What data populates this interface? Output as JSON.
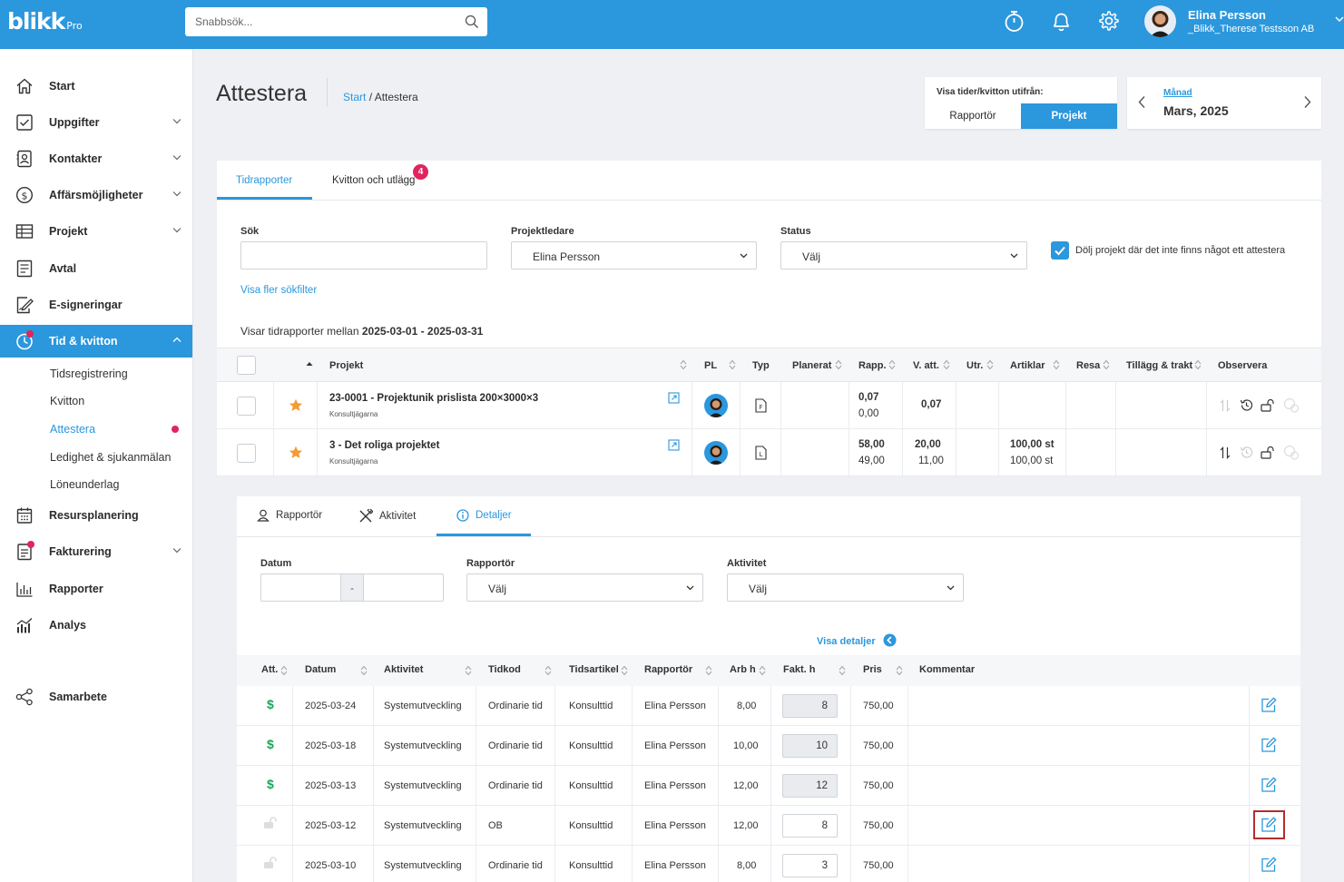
{
  "colors": {
    "brand": "#2b97dd",
    "badge": "#e0245e",
    "dollar": "#1aa35c",
    "highlight": "#b32d2d"
  },
  "topbar": {
    "logo_main": "blikk",
    "logo_sub": "Pro",
    "search_placeholder": "Snabbsök...",
    "icons": [
      "stopwatch-icon",
      "bell-icon",
      "gear-icon"
    ],
    "user_name": "Elina Persson",
    "user_org": "_Blikk_Therese Testsson AB"
  },
  "sidebar": {
    "items": [
      {
        "label": "Start",
        "icon": "home-icon"
      },
      {
        "label": "Uppgifter",
        "icon": "checkbox-icon"
      },
      {
        "label": "Kontakter",
        "icon": "contacts-icon"
      },
      {
        "label": "Affärsmöjligheter",
        "icon": "dollar-circle-icon"
      },
      {
        "label": "Projekt",
        "icon": "grid-icon"
      },
      {
        "label": "Avtal",
        "icon": "document-icon"
      },
      {
        "label": "E-signeringar",
        "icon": "signature-icon"
      },
      {
        "label": "Tid & kvitton",
        "icon": "clock-icon"
      },
      {
        "label": "Resursplanering",
        "icon": "calendar-icon"
      },
      {
        "label": "Fakturering",
        "icon": "invoice-icon"
      },
      {
        "label": "Rapporter",
        "icon": "bar-chart-icon"
      },
      {
        "label": "Analys",
        "icon": "analysis-icon"
      },
      {
        "label": "Samarbete",
        "icon": "share-icon"
      }
    ],
    "sub_items": [
      "Tidsregistrering",
      "Kvitton",
      "Attestera",
      "Ledighet & sjukanmälan",
      "Löneunderlag"
    ]
  },
  "header": {
    "title": "Attestera",
    "crumb_start": "Start",
    "crumb_sep": "/",
    "crumb_current": "Attestera"
  },
  "view": {
    "label": "Visa tider/kvitton utifrån:",
    "options": [
      "Rapportör",
      "Projekt"
    ],
    "selected": "Projekt"
  },
  "period": {
    "mode": "Månad",
    "value": "Mars, 2025"
  },
  "tabs": [
    {
      "label": "Tidrapporter"
    },
    {
      "label": "Kvitton och utlägg",
      "badge": "4"
    }
  ],
  "filters": {
    "search_label": "Sök",
    "search_value": "",
    "pl_label": "Projektledare",
    "pl_value": "Elina Persson",
    "status_label": "Status",
    "status_value": "Välj",
    "hide_label": "Dölj projekt där det inte finns något ett attestera",
    "more_filters": "Visa fler sökfilter"
  },
  "range": {
    "prefix": "Visar tidrapporter mellan",
    "value": "2025-03-01 - 2025-03-31"
  },
  "projects_table": {
    "headers": [
      "Projekt",
      "PL",
      "Typ",
      "Planerat",
      "Rapp.",
      "V. att.",
      "Utr.",
      "Artiklar",
      "Resa",
      "Tillägg & trakt",
      "Observera"
    ],
    "rows": [
      {
        "name": "23-0001 - Projektunik prislista 200×3000×3",
        "client": "Konsultjägarna",
        "rapp": "0,07",
        "rapp2": "0,00",
        "vatt": "0,07",
        "vatt2": "",
        "artiklar": "",
        "artiklar2": ""
      },
      {
        "name": "3 - Det roliga projektet",
        "client": "Konsultjägarna",
        "rapp": "58,00",
        "rapp2": "49,00",
        "vatt": "20,00",
        "vatt2": "11,00",
        "artiklar": "100,00 st",
        "artiklar2": "100,00 st"
      }
    ]
  },
  "detail": {
    "tabs": [
      "Rapportör",
      "Aktivitet",
      "Detaljer"
    ],
    "active_tab": "Detaljer",
    "date_label": "Datum",
    "date_sep": "-",
    "reporter_label": "Rapportör",
    "reporter_value": "Välj",
    "activity_label": "Aktivitet",
    "activity_value": "Välj",
    "show_details": "Visa detaljer",
    "headers": [
      "Att.",
      "Datum",
      "Aktivitet",
      "Tidkod",
      "Tidsartikel",
      "Rapportör",
      "Arb h",
      "Fakt. h",
      "Pris",
      "Kommentar"
    ],
    "rows": [
      {
        "att": "$",
        "date": "2025-03-24",
        "activity": "Systemutveckling",
        "code": "Ordinarie tid",
        "article": "Konsulttid",
        "reporter": "Elina Persson",
        "arb": "8,00",
        "fakt": "8",
        "pris": "750,00",
        "comment": "",
        "locked": false
      },
      {
        "att": "$",
        "date": "2025-03-18",
        "activity": "Systemutveckling",
        "code": "Ordinarie tid",
        "article": "Konsulttid",
        "reporter": "Elina Persson",
        "arb": "10,00",
        "fakt": "10",
        "pris": "750,00",
        "comment": "",
        "locked": false
      },
      {
        "att": "$",
        "date": "2025-03-13",
        "activity": "Systemutveckling",
        "code": "Ordinarie tid",
        "article": "Konsulttid",
        "reporter": "Elina Persson",
        "arb": "12,00",
        "fakt": "12",
        "pris": "750,00",
        "comment": "",
        "locked": false
      },
      {
        "att": "",
        "date": "2025-03-12",
        "activity": "Systemutveckling",
        "code": "OB",
        "article": "Konsulttid",
        "reporter": "Elina Persson",
        "arb": "12,00",
        "fakt": "8",
        "pris": "750,00",
        "comment": "",
        "locked": true
      },
      {
        "att": "",
        "date": "2025-03-10",
        "activity": "Systemutveckling",
        "code": "Ordinarie tid",
        "article": "Konsulttid",
        "reporter": "Elina Persson",
        "arb": "8,00",
        "fakt": "3",
        "pris": "750,00",
        "comment": "",
        "locked": true
      }
    ]
  }
}
